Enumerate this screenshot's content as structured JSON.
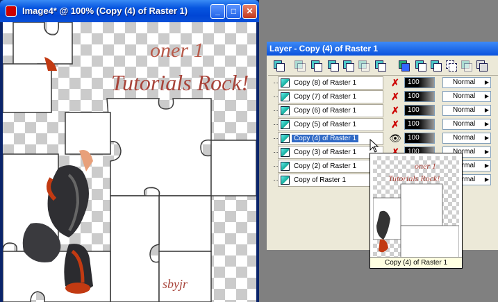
{
  "image_window": {
    "title": "Image4* @ 100% (Copy (4) of Raster 1)",
    "minimize": "_",
    "maximize": "□",
    "close": "✕",
    "canvas_text_top": "oner 1",
    "canvas_text_main": "Tutorials Rock!",
    "canvas_text_bottom": "sbyjr"
  },
  "layer_palette": {
    "title": "Layer - Copy (4) of Raster 1",
    "layers": [
      {
        "name": "Copy (8) of Raster 1",
        "visible": false,
        "opacity": "100",
        "blend": "Normal",
        "selected": false
      },
      {
        "name": "Copy (7) of Raster 1",
        "visible": false,
        "opacity": "100",
        "blend": "Normal",
        "selected": false
      },
      {
        "name": "Copy (6) of Raster 1",
        "visible": false,
        "opacity": "100",
        "blend": "Normal",
        "selected": false
      },
      {
        "name": "Copy (5) of Raster 1",
        "visible": false,
        "opacity": "100",
        "blend": "Normal",
        "selected": false
      },
      {
        "name": "Copy (4) of Raster 1",
        "visible": true,
        "opacity": "100",
        "blend": "Normal",
        "selected": true
      },
      {
        "name": "Copy (3) of Raster 1",
        "visible": false,
        "opacity": "100",
        "blend": "Normal",
        "selected": false
      },
      {
        "name": "Copy (2) of Raster 1",
        "visible": false,
        "opacity": "100",
        "blend": "Normal",
        "selected": false
      },
      {
        "name": "Copy of Raster 1",
        "visible": false,
        "opacity": "100",
        "blend": "Normal",
        "selected": false
      }
    ]
  },
  "thumbnail": {
    "caption": "Copy (4) of Raster 1",
    "text_top": "oner 1",
    "text_main": "Tutorials Rock!"
  },
  "colors": {
    "title_bar": "#0a52dd",
    "selection": "#316ac5",
    "hidden_marker": "#cc0000"
  }
}
